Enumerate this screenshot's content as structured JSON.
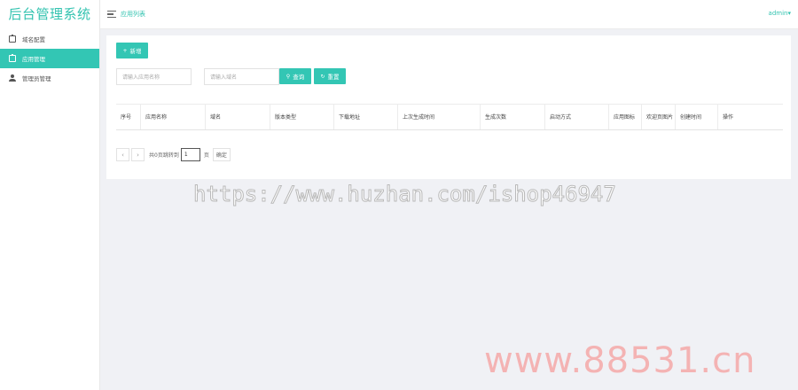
{
  "app": {
    "title": "后台管理系统"
  },
  "sidebar": {
    "items": [
      {
        "label": "域名配置",
        "icon": "clipboard-icon",
        "active": false
      },
      {
        "label": "应用管理",
        "icon": "clipboard-icon",
        "active": true
      },
      {
        "label": "管理员管理",
        "icon": "user-icon",
        "active": false
      }
    ]
  },
  "header": {
    "breadcrumb": "应用列表",
    "user": "admin▾"
  },
  "toolbar": {
    "add_label": "新增",
    "name_placeholder": "请输入应用名称",
    "domain_placeholder": "请输入域名",
    "search_label": "查询",
    "reset_label": "重置"
  },
  "table": {
    "columns": [
      "序号",
      "应用名称",
      "域名",
      "版本类型",
      "下载地址",
      "上次生成时间",
      "生成次数",
      "启动方式",
      "应用图标",
      "欢迎页图片",
      "创建时间",
      "操作"
    ],
    "rows": []
  },
  "pagination": {
    "prev": "‹",
    "next": "›",
    "summary": "共0页跳转到",
    "page_value": "1",
    "unit": "页",
    "go_label": "确定"
  },
  "watermarks": {
    "url": "https://www.huzhan.com/ishop46947",
    "site": "www.88531.cn"
  },
  "colors": {
    "accent": "#33c6b4",
    "background": "#f0f1f5"
  }
}
